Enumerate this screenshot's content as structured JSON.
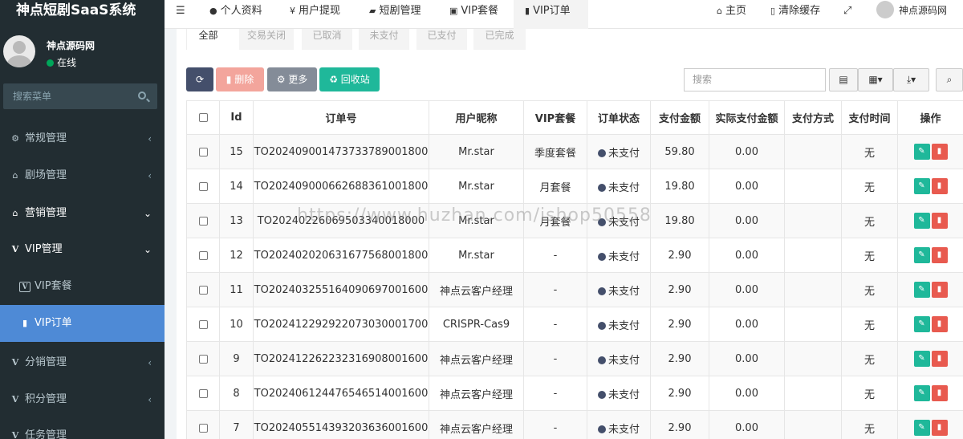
{
  "brand": {
    "title": "神点短剧SaaS系统"
  },
  "user": {
    "name": "神点源码网",
    "status": "在线"
  },
  "sidebar": {
    "search_placeholder": "搜索菜单",
    "items": [
      {
        "label": "常规管理",
        "icon": "cogs-icon"
      },
      {
        "label": "剧场管理",
        "icon": "home-icon"
      },
      {
        "label": "营销管理",
        "icon": "home-icon"
      },
      {
        "label": "VIP管理",
        "icon": "v-icon"
      },
      {
        "label": "VIP套餐",
        "icon": "v-square-icon"
      },
      {
        "label": "VIP订单",
        "icon": "file-icon"
      },
      {
        "label": "分销管理",
        "icon": "v-icon"
      },
      {
        "label": "积分管理",
        "icon": "v-icon"
      },
      {
        "label": "任务管理",
        "icon": "v-icon"
      }
    ]
  },
  "topnav": {
    "items": [
      {
        "label": "个人资料",
        "icon": "user-icon"
      },
      {
        "label": "用户提现",
        "icon": "yen-icon"
      },
      {
        "label": "短剧管理",
        "icon": "briefcase-icon"
      },
      {
        "label": "VIP套餐",
        "icon": "v-square-icon"
      },
      {
        "label": "VIP订单",
        "icon": "file-icon"
      }
    ],
    "home": "主页",
    "clear_cache": "清除缓存",
    "username": "神点源码网"
  },
  "tabs": [
    "全部",
    "交易关闭",
    "已取消",
    "未支付",
    "已支付",
    "已完成"
  ],
  "toolbar": {
    "delete": "删除",
    "more": "更多",
    "recycle": "回收站",
    "search_placeholder": "搜索"
  },
  "table": {
    "headers": [
      "Id",
      "订单号",
      "用户昵称",
      "VIP套餐",
      "订单状态",
      "支付金额",
      "实际支付金额",
      "支付方式",
      "支付时间",
      "操作"
    ],
    "rows": [
      {
        "id": "15",
        "order": "TO20240900147373378900180​0",
        "nick": "Mr.star",
        "pkg": "季度套餐",
        "status": "未支付",
        "amount": "59.80",
        "actual": "0.00",
        "method": "",
        "time": "无"
      },
      {
        "id": "14",
        "order": "TO20240900066268836100180​0",
        "nick": "Mr.star",
        "pkg": "月套餐",
        "status": "未支付",
        "amount": "19.80",
        "actual": "0.00",
        "method": "",
        "time": "无"
      },
      {
        "id": "13",
        "order": "TO20240226069503340018000",
        "nick": "Mr.star",
        "pkg": "月套餐",
        "status": "未支付",
        "amount": "19.80",
        "actual": "0.00",
        "method": "",
        "time": "无"
      },
      {
        "id": "12",
        "order": "TO20240202063167756800180​0",
        "nick": "Mr.star",
        "pkg": "-",
        "status": "未支付",
        "amount": "2.90",
        "actual": "0.00",
        "method": "",
        "time": "无"
      },
      {
        "id": "11",
        "order": "TO20240325516409069700160​0",
        "nick": "神点云客户经理",
        "pkg": "-",
        "status": "未支付",
        "amount": "2.90",
        "actual": "0.00",
        "method": "",
        "time": "无"
      },
      {
        "id": "10",
        "order": "TO20241229292207303000170​0",
        "nick": "CRISPR-Cas9",
        "pkg": "-",
        "status": "未支付",
        "amount": "2.90",
        "actual": "0.00",
        "method": "",
        "time": "无"
      },
      {
        "id": "9",
        "order": "TO20241226223231690800160​0",
        "nick": "神点云客户经理",
        "pkg": "-",
        "status": "未支付",
        "amount": "2.90",
        "actual": "0.00",
        "method": "",
        "time": "无"
      },
      {
        "id": "8",
        "order": "TO20240612447654651400160​0",
        "nick": "神点云客户经理",
        "pkg": "-",
        "status": "未支付",
        "amount": "2.90",
        "actual": "0.00",
        "method": "",
        "time": "无"
      },
      {
        "id": "7",
        "order": "TO20240551439320363600160​0",
        "nick": "神点云客户经理",
        "pkg": "-",
        "status": "未支付",
        "amount": "2.90",
        "actual": "0.00",
        "method": "",
        "time": "无"
      }
    ]
  },
  "watermark": "https://www.huzhan.com/ishop50558"
}
